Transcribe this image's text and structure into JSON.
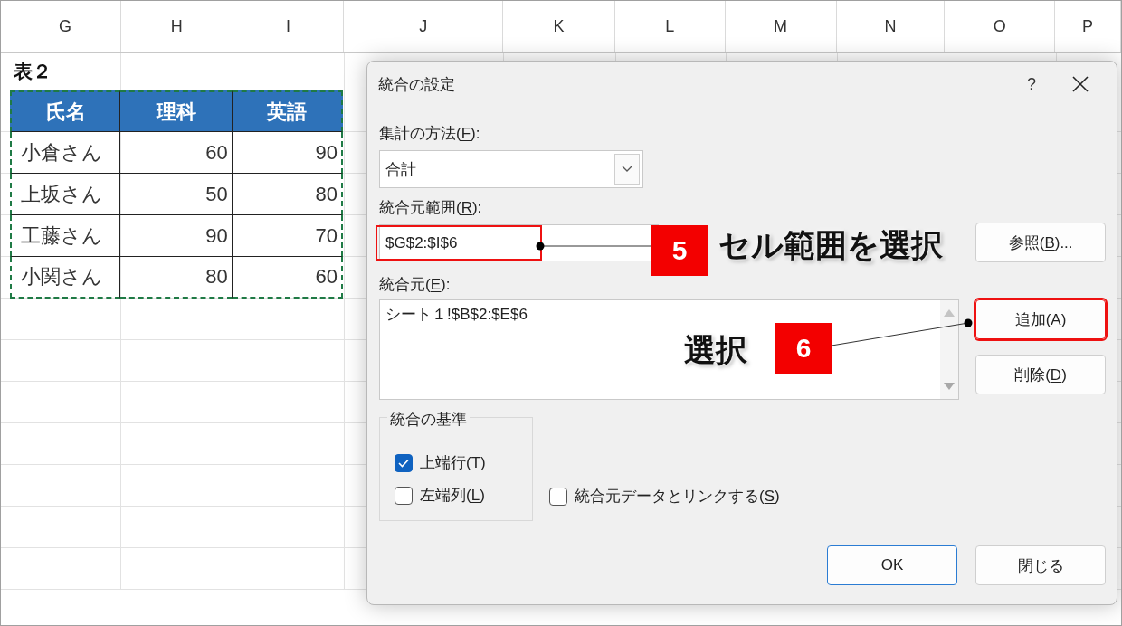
{
  "sheet": {
    "columns": [
      "G",
      "H",
      "I",
      "J",
      "K",
      "L",
      "M",
      "N",
      "O",
      "P"
    ],
    "title": "表２",
    "table": {
      "columns": [
        "氏名",
        "理科",
        "英語"
      ],
      "rows": [
        [
          "小倉さん",
          "60",
          "90"
        ],
        [
          "上坂さん",
          "50",
          "80"
        ],
        [
          "工藤さん",
          "90",
          "70"
        ],
        [
          "小関さん",
          "80",
          "60"
        ]
      ]
    }
  },
  "dialog": {
    "title": "統合の設定",
    "help": "?",
    "function": {
      "label": {
        "before": "集計の方法(",
        "key": "F",
        "after": "):"
      },
      "value": "合計"
    },
    "reference": {
      "label": {
        "before": "統合元範囲(",
        "key": "R",
        "after": "):"
      },
      "value": "$G$2:$I$6",
      "highlighted": true,
      "browse": {
        "before": "参照(",
        "key": "B",
        "after": ")...",
        "highlighted": false
      }
    },
    "references": {
      "label": {
        "before": "統合元(",
        "key": "E",
        "after": "):"
      },
      "items": [
        "シート１!$B$2:$E$6"
      ],
      "add": {
        "before": "追加(",
        "key": "A",
        "after": ")",
        "highlighted": true
      },
      "delete": {
        "before": "削除(",
        "key": "D",
        "after": ")",
        "highlighted": false
      }
    },
    "use_labels": {
      "title": "統合の基準",
      "options": [
        {
          "before": "上端行(",
          "key": "T",
          "after": ")",
          "checked": true
        },
        {
          "before": "左端列(",
          "key": "L",
          "after": ")",
          "checked": false
        }
      ]
    },
    "link": {
      "before": "統合元データとリンクする(",
      "key": "S",
      "after": ")",
      "checked": false
    },
    "buttons": [
      {
        "label": "OK",
        "default": true
      },
      {
        "label": "閉じる",
        "default": false
      }
    ]
  },
  "annotations": [
    {
      "number": "5",
      "text": "セル範囲を選択"
    },
    {
      "number": "6",
      "text": "選択"
    }
  ]
}
